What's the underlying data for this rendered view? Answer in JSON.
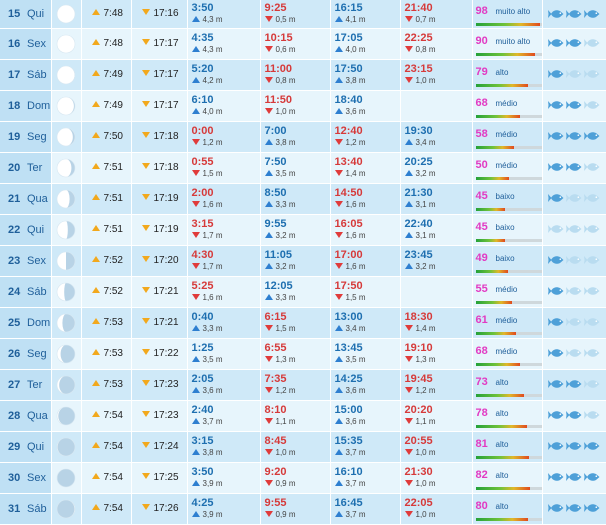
{
  "colors": {
    "fish_active": "#4ea0d8",
    "fish_inactive": "#b9dcf0",
    "moon_lit": "#ffffff",
    "moon_dark": "#b8d3e6"
  },
  "rows": [
    {
      "day": "15",
      "weekday": "Qui",
      "moon_illum": 0.99,
      "moon_waxing": true,
      "sunrise": "7:48",
      "sunset": "17:16",
      "tides": [
        {
          "time": "3:50",
          "height": "4,3 m",
          "type": "high"
        },
        {
          "time": "9:25",
          "height": "0,5 m",
          "type": "low"
        },
        {
          "time": "16:15",
          "height": "4,1 m",
          "type": "high"
        },
        {
          "time": "21:40",
          "height": "0,7 m",
          "type": "low"
        }
      ],
      "coef": "98",
      "coef_label": "muito alto",
      "coef_level": 0.98,
      "fish": "3"
    },
    {
      "day": "16",
      "weekday": "Sex",
      "moon_illum": 1.0,
      "moon_waxing": true,
      "sunrise": "7:48",
      "sunset": "17:17",
      "tides": [
        {
          "time": "4:35",
          "height": "4,3 m",
          "type": "high"
        },
        {
          "time": "10:15",
          "height": "0,6 m",
          "type": "low"
        },
        {
          "time": "17:05",
          "height": "4,0 m",
          "type": "high"
        },
        {
          "time": "22:25",
          "height": "0,8 m",
          "type": "low"
        }
      ],
      "coef": "90",
      "coef_label": "muito alto",
      "coef_level": 0.9,
      "fish": "2"
    },
    {
      "day": "17",
      "weekday": "Sáb",
      "moon_illum": 0.98,
      "moon_waxing": false,
      "sunrise": "7:49",
      "sunset": "17:17",
      "tides": [
        {
          "time": "5:20",
          "height": "4,2 m",
          "type": "high"
        },
        {
          "time": "11:00",
          "height": "0,8 m",
          "type": "low"
        },
        {
          "time": "17:50",
          "height": "3,8 m",
          "type": "high"
        },
        {
          "time": "23:15",
          "height": "1,0 m",
          "type": "low"
        }
      ],
      "coef": "79",
      "coef_label": "alto",
      "coef_level": 0.79,
      "fish": "1"
    },
    {
      "day": "18",
      "weekday": "Dom",
      "moon_illum": 0.94,
      "moon_waxing": false,
      "sunrise": "7:49",
      "sunset": "17:17",
      "tides": [
        {
          "time": "6:10",
          "height": "4,0 m",
          "type": "high"
        },
        {
          "time": "11:50",
          "height": "1,0 m",
          "type": "low"
        },
        {
          "time": "18:40",
          "height": "3,6 m",
          "type": "high"
        },
        {
          "time": "",
          "height": "",
          "type": "none"
        }
      ],
      "coef": "68",
      "coef_label": "médio",
      "coef_level": 0.68,
      "fish": "2"
    },
    {
      "day": "19",
      "weekday": "Seg",
      "moon_illum": 0.88,
      "moon_waxing": false,
      "sunrise": "7:50",
      "sunset": "17:18",
      "tides": [
        {
          "time": "0:00",
          "height": "1,2 m",
          "type": "low"
        },
        {
          "time": "7:00",
          "height": "3,8 m",
          "type": "high"
        },
        {
          "time": "12:40",
          "height": "1,2 m",
          "type": "low"
        },
        {
          "time": "19:30",
          "height": "3,4 m",
          "type": "high"
        }
      ],
      "coef": "58",
      "coef_label": "médio",
      "coef_level": 0.58,
      "fish": "3"
    },
    {
      "day": "20",
      "weekday": "Ter",
      "moon_illum": 0.8,
      "moon_waxing": false,
      "sunrise": "7:51",
      "sunset": "17:18",
      "tides": [
        {
          "time": "0:55",
          "height": "1,5 m",
          "type": "low"
        },
        {
          "time": "7:50",
          "height": "3,5 m",
          "type": "high"
        },
        {
          "time": "13:40",
          "height": "1,4 m",
          "type": "low"
        },
        {
          "time": "20:25",
          "height": "3,2 m",
          "type": "high"
        }
      ],
      "coef": "50",
      "coef_label": "médio",
      "coef_level": 0.5,
      "fish": "2"
    },
    {
      "day": "21",
      "weekday": "Qua",
      "moon_illum": 0.7,
      "moon_waxing": false,
      "sunrise": "7:51",
      "sunset": "17:19",
      "tides": [
        {
          "time": "2:00",
          "height": "1,6 m",
          "type": "low"
        },
        {
          "time": "8:50",
          "height": "3,3 m",
          "type": "high"
        },
        {
          "time": "14:50",
          "height": "1,6 m",
          "type": "low"
        },
        {
          "time": "21:30",
          "height": "3,1 m",
          "type": "high"
        }
      ],
      "coef": "45",
      "coef_label": "baixo",
      "coef_level": 0.45,
      "fish": "1"
    },
    {
      "day": "22",
      "weekday": "Qui",
      "moon_illum": 0.6,
      "moon_waxing": false,
      "sunrise": "7:51",
      "sunset": "17:19",
      "tides": [
        {
          "time": "3:15",
          "height": "1,7 m",
          "type": "low"
        },
        {
          "time": "9:55",
          "height": "3,2 m",
          "type": "high"
        },
        {
          "time": "16:05",
          "height": "1,6 m",
          "type": "low"
        },
        {
          "time": "22:40",
          "height": "3,1 m",
          "type": "high"
        }
      ],
      "coef": "45",
      "coef_label": "baixo",
      "coef_level": 0.45,
      "fish": "0"
    },
    {
      "day": "23",
      "weekday": "Sex",
      "moon_illum": 0.5,
      "moon_waxing": false,
      "sunrise": "7:52",
      "sunset": "17:20",
      "tides": [
        {
          "time": "4:30",
          "height": "1,7 m",
          "type": "low"
        },
        {
          "time": "11:05",
          "height": "3,2 m",
          "type": "high"
        },
        {
          "time": "17:00",
          "height": "1,6 m",
          "type": "low"
        },
        {
          "time": "23:45",
          "height": "3,2 m",
          "type": "high"
        }
      ],
      "coef": "49",
      "coef_label": "baixo",
      "coef_level": 0.49,
      "fish": "1"
    },
    {
      "day": "24",
      "weekday": "Sáb",
      "moon_illum": 0.4,
      "moon_waxing": false,
      "sunrise": "7:52",
      "sunset": "17:21",
      "tides": [
        {
          "time": "5:25",
          "height": "1,6 m",
          "type": "low"
        },
        {
          "time": "12:05",
          "height": "3,3 m",
          "type": "high"
        },
        {
          "time": "17:50",
          "height": "1,5 m",
          "type": "low"
        },
        {
          "time": "",
          "height": "",
          "type": "none"
        }
      ],
      "coef": "55",
      "coef_label": "médio",
      "coef_level": 0.55,
      "fish": "1"
    },
    {
      "day": "25",
      "weekday": "Dom",
      "moon_illum": 0.3,
      "moon_waxing": false,
      "sunrise": "7:53",
      "sunset": "17:21",
      "tides": [
        {
          "time": "0:40",
          "height": "3,3 m",
          "type": "high"
        },
        {
          "time": "6:15",
          "height": "1,5 m",
          "type": "low"
        },
        {
          "time": "13:00",
          "height": "3,4 m",
          "type": "high"
        },
        {
          "time": "18:30",
          "height": "1,4 m",
          "type": "low"
        }
      ],
      "coef": "61",
      "coef_label": "médio",
      "coef_level": 0.61,
      "fish": "1"
    },
    {
      "day": "26",
      "weekday": "Seg",
      "moon_illum": 0.2,
      "moon_waxing": false,
      "sunrise": "7:53",
      "sunset": "17:22",
      "tides": [
        {
          "time": "1:25",
          "height": "3,5 m",
          "type": "high"
        },
        {
          "time": "6:55",
          "height": "1,3 m",
          "type": "low"
        },
        {
          "time": "13:45",
          "height": "3,5 m",
          "type": "high"
        },
        {
          "time": "19:10",
          "height": "1,3 m",
          "type": "low"
        }
      ],
      "coef": "68",
      "coef_label": "médio",
      "coef_level": 0.68,
      "fish": "1"
    },
    {
      "day": "27",
      "weekday": "Ter",
      "moon_illum": 0.12,
      "moon_waxing": false,
      "sunrise": "7:53",
      "sunset": "17:23",
      "tides": [
        {
          "time": "2:05",
          "height": "3,6 m",
          "type": "high"
        },
        {
          "time": "7:35",
          "height": "1,2 m",
          "type": "low"
        },
        {
          "time": "14:25",
          "height": "3,6 m",
          "type": "high"
        },
        {
          "time": "19:45",
          "height": "1,2 m",
          "type": "low"
        }
      ],
      "coef": "73",
      "coef_label": "alto",
      "coef_level": 0.73,
      "fish": "2"
    },
    {
      "day": "28",
      "weekday": "Qua",
      "moon_illum": 0.07,
      "moon_waxing": false,
      "sunrise": "7:54",
      "sunset": "17:23",
      "tides": [
        {
          "time": "2:40",
          "height": "3,7 m",
          "type": "high"
        },
        {
          "time": "8:10",
          "height": "1,1 m",
          "type": "low"
        },
        {
          "time": "15:00",
          "height": "3,6 m",
          "type": "high"
        },
        {
          "time": "20:20",
          "height": "1,1 m",
          "type": "low"
        }
      ],
      "coef": "78",
      "coef_label": "alto",
      "coef_level": 0.78,
      "fish": "2"
    },
    {
      "day": "29",
      "weekday": "Qui",
      "moon_illum": 0.03,
      "moon_waxing": false,
      "sunrise": "7:54",
      "sunset": "17:24",
      "tides": [
        {
          "time": "3:15",
          "height": "3,8 m",
          "type": "high"
        },
        {
          "time": "8:45",
          "height": "1,0 m",
          "type": "low"
        },
        {
          "time": "15:35",
          "height": "3,7 m",
          "type": "high"
        },
        {
          "time": "20:55",
          "height": "1,0 m",
          "type": "low"
        }
      ],
      "coef": "81",
      "coef_label": "alto",
      "coef_level": 0.81,
      "fish": "3"
    },
    {
      "day": "30",
      "weekday": "Sex",
      "moon_illum": 0.01,
      "moon_waxing": false,
      "sunrise": "7:54",
      "sunset": "17:25",
      "tides": [
        {
          "time": "3:50",
          "height": "3,9 m",
          "type": "high"
        },
        {
          "time": "9:20",
          "height": "0,9 m",
          "type": "low"
        },
        {
          "time": "16:10",
          "height": "3,7 m",
          "type": "high"
        },
        {
          "time": "21:30",
          "height": "1,0 m",
          "type": "low"
        }
      ],
      "coef": "82",
      "coef_label": "alto",
      "coef_level": 0.82,
      "fish": "3"
    },
    {
      "day": "31",
      "weekday": "Sáb",
      "moon_illum": 0.03,
      "moon_waxing": true,
      "sunrise": "7:54",
      "sunset": "17:26",
      "tides": [
        {
          "time": "4:25",
          "height": "3,9 m",
          "type": "high"
        },
        {
          "time": "9:55",
          "height": "0,9 m",
          "type": "low"
        },
        {
          "time": "16:45",
          "height": "3,7 m",
          "type": "high"
        },
        {
          "time": "22:05",
          "height": "1,0 m",
          "type": "low"
        }
      ],
      "coef": "80",
      "coef_label": "alto",
      "coef_level": 0.8,
      "fish": "3"
    }
  ]
}
